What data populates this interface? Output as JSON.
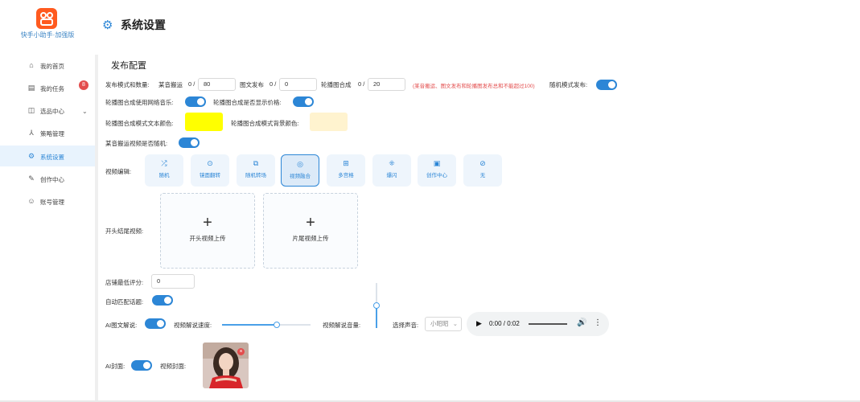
{
  "app": {
    "name": "快手小助手·加强版",
    "page_title": "系统设置",
    "section_title": "发布配置"
  },
  "sidebar": {
    "items": [
      {
        "label": "我的首页",
        "icon": "home-icon"
      },
      {
        "label": "我的任务",
        "icon": "task-icon",
        "badge": "8"
      },
      {
        "label": "选品中心",
        "icon": "bag-icon"
      },
      {
        "label": "策略管理",
        "icon": "strategy-icon"
      },
      {
        "label": "系统设置",
        "icon": "gear-icon",
        "active": true
      },
      {
        "label": "创作中心",
        "icon": "edit-icon"
      },
      {
        "label": "账号管理",
        "icon": "user-icon"
      }
    ]
  },
  "form": {
    "mode_count_label": "发布模式和数量:",
    "video_move_label": "某音搬运",
    "video_move_prefix": "0 /",
    "video_move_value": "80",
    "image_post_label": "图文发布",
    "image_post_prefix": "0 /",
    "image_post_value": "0",
    "carousel_label": "轮播图合成",
    "carousel_prefix": "0 /",
    "carousel_value": "20",
    "limit_warning": "(某音搬运、图文发布和轮播图发布总和不能超过100)",
    "random_mode_label": "随机模式发布:",
    "carousel_music_label": "轮播图合成使用网络音乐:",
    "carousel_price_label": "轮播图合成是否显示价格:",
    "text_color_label": "轮播图合成模式文本颜色:",
    "text_color": "#ffff00",
    "bg_color_label": "轮播图合成模式背景颜色:",
    "bg_color": "#fff3cf",
    "random_video_label": "某音搬运视频是否随机:",
    "edit_label": "视频编辑:",
    "effects": [
      {
        "label": "随机",
        "icon": "shuffle-icon"
      },
      {
        "label": "镜面翻转",
        "icon": "mirror-icon"
      },
      {
        "label": "随机转场",
        "icon": "transition-icon"
      },
      {
        "label": "视频融合",
        "icon": "blend-icon",
        "selected": true
      },
      {
        "label": "多宫格",
        "icon": "grid-icon"
      },
      {
        "label": "爆闪",
        "icon": "flash-icon"
      },
      {
        "label": "创作中心",
        "icon": "create-icon"
      },
      {
        "label": "无",
        "icon": "none-icon"
      }
    ],
    "intro_outro_label": "开头结尾视频:",
    "upload_intro_label": "开头视频上传",
    "upload_outro_label": "片尾视频上传",
    "min_score_label": "店铺最低评分:",
    "min_score_value": "0",
    "auto_topic_label": "自动匹配话题:",
    "ai_narration_label": "AI图文解说:",
    "narration_speed_label": "视频解说速度:",
    "narration_speed_level": 0.62,
    "narration_volume_label": "视频解说音量:",
    "voice_label": "选择声音:",
    "voice_value": "小昭昭",
    "audio_time": "0:00 / 0:02",
    "ai_cover_label": "AI封面:",
    "video_cover_label": "视频封面:"
  },
  "colors": {
    "accent": "#2c86d6",
    "warning": "#e34d4d",
    "logo": "#ff5a1f"
  }
}
